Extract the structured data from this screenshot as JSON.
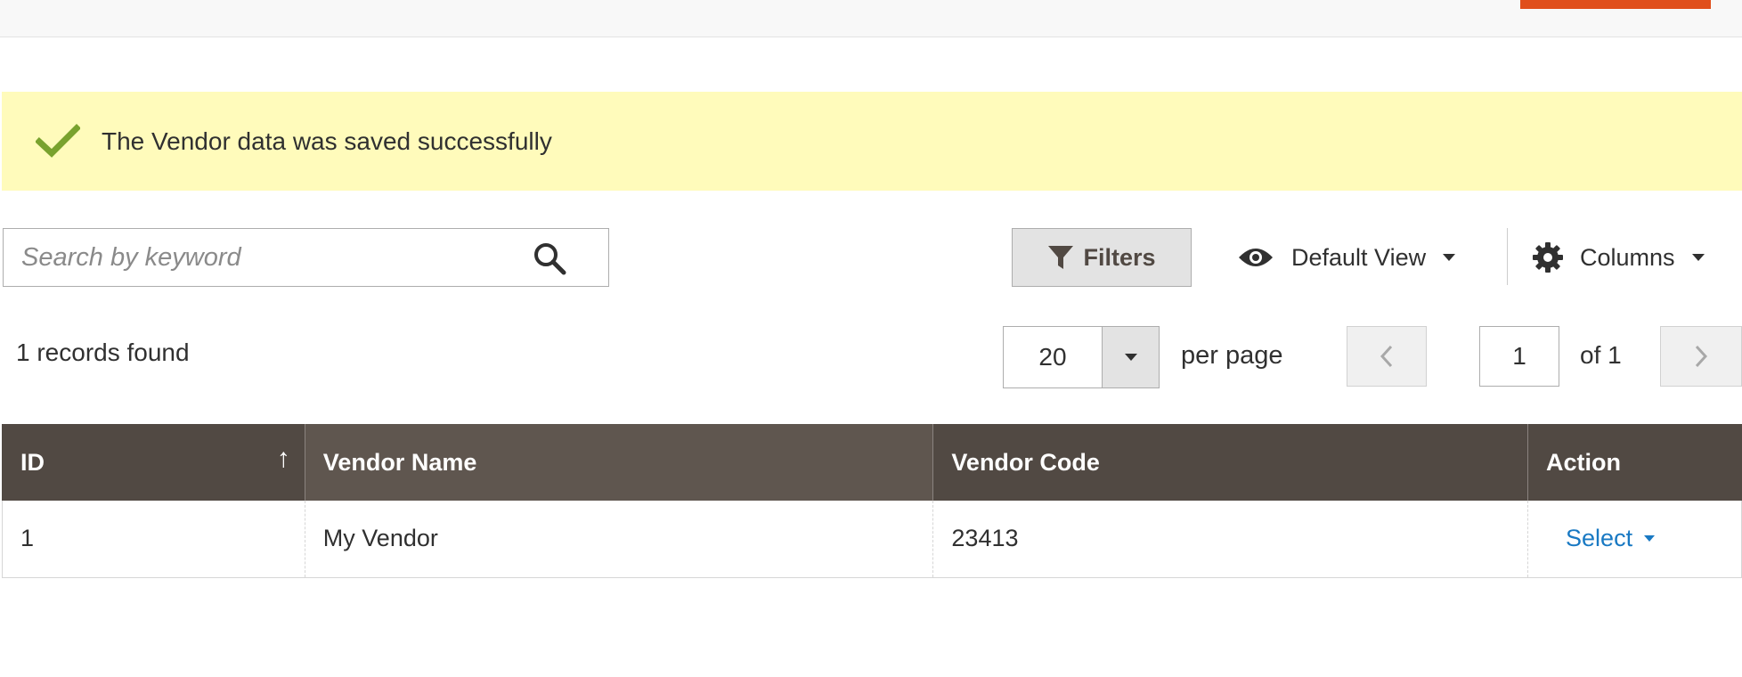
{
  "message": {
    "text": "The Vendor data was saved successfully",
    "icon": "checkmark-icon",
    "color": "#79a22e",
    "background": "#fffbbb"
  },
  "search": {
    "placeholder": "Search by keyword",
    "value": "",
    "icon": "search-icon"
  },
  "toolbar": {
    "filters_label": "Filters",
    "filters_icon": "funnel-icon",
    "view_label": "Default View",
    "view_icon": "eye-icon",
    "columns_label": "Columns",
    "columns_icon": "gear-icon"
  },
  "records_found": "1 records found",
  "pagination": {
    "per_page_value": "20",
    "per_page_label": "per page",
    "current_page": "1",
    "of_pages": "of 1"
  },
  "grid": {
    "columns": [
      "ID",
      "Vendor Name",
      "Vendor Code",
      "Action"
    ],
    "sort_indicator": "↑",
    "rows": [
      {
        "id": "1",
        "vendor_name": "My Vendor",
        "vendor_code": "23413",
        "action": "Select"
      }
    ]
  },
  "colors": {
    "header_bg": "#514943",
    "accent": "#e04f1c",
    "link": "#1979c3"
  }
}
